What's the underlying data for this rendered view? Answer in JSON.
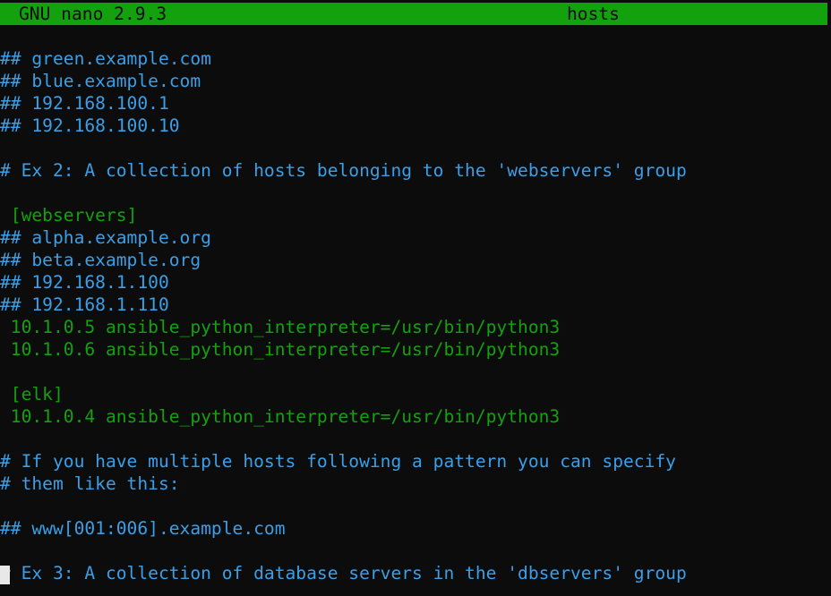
{
  "colors": {
    "background": "#0c0c0c",
    "titlebar_bg": "#13a10e",
    "titlebar_fg": "#0c0c0c",
    "comment": "#3b9fe8",
    "code": "#13a10e"
  },
  "titlebar": {
    "app": "GNU nano 2.9.3",
    "file": "hosts"
  },
  "lines": [
    {
      "type": "comment",
      "text": "## green.example.com"
    },
    {
      "type": "comment",
      "text": "## blue.example.com"
    },
    {
      "type": "comment",
      "text": "## 192.168.100.1"
    },
    {
      "type": "comment",
      "text": "## 192.168.100.10"
    },
    {
      "type": "blank",
      "text": ""
    },
    {
      "type": "comment",
      "text": "# Ex 2: A collection of hosts belonging to the 'webservers' group"
    },
    {
      "type": "blank",
      "text": ""
    },
    {
      "type": "code",
      "text": " [webservers]"
    },
    {
      "type": "comment",
      "text": "## alpha.example.org"
    },
    {
      "type": "comment",
      "text": "## beta.example.org"
    },
    {
      "type": "comment",
      "text": "## 192.168.1.100"
    },
    {
      "type": "comment",
      "text": "## 192.168.1.110"
    },
    {
      "type": "code",
      "text": " 10.1.0.5 ansible_python_interpreter=/usr/bin/python3"
    },
    {
      "type": "code",
      "text": " 10.1.0.6 ansible_python_interpreter=/usr/bin/python3"
    },
    {
      "type": "blank",
      "text": ""
    },
    {
      "type": "code",
      "text": " [elk]"
    },
    {
      "type": "code",
      "text": " 10.1.0.4 ansible_python_interpreter=/usr/bin/python3"
    },
    {
      "type": "blank",
      "text": ""
    },
    {
      "type": "comment",
      "text": "# If you have multiple hosts following a pattern you can specify"
    },
    {
      "type": "comment",
      "text": "# them like this:"
    },
    {
      "type": "blank",
      "text": ""
    },
    {
      "type": "comment",
      "text": "## www[001:006].example.com"
    },
    {
      "type": "blank",
      "text": ""
    },
    {
      "type": "comment",
      "text": "# Ex 3: A collection of database servers in the 'dbservers' group"
    }
  ]
}
